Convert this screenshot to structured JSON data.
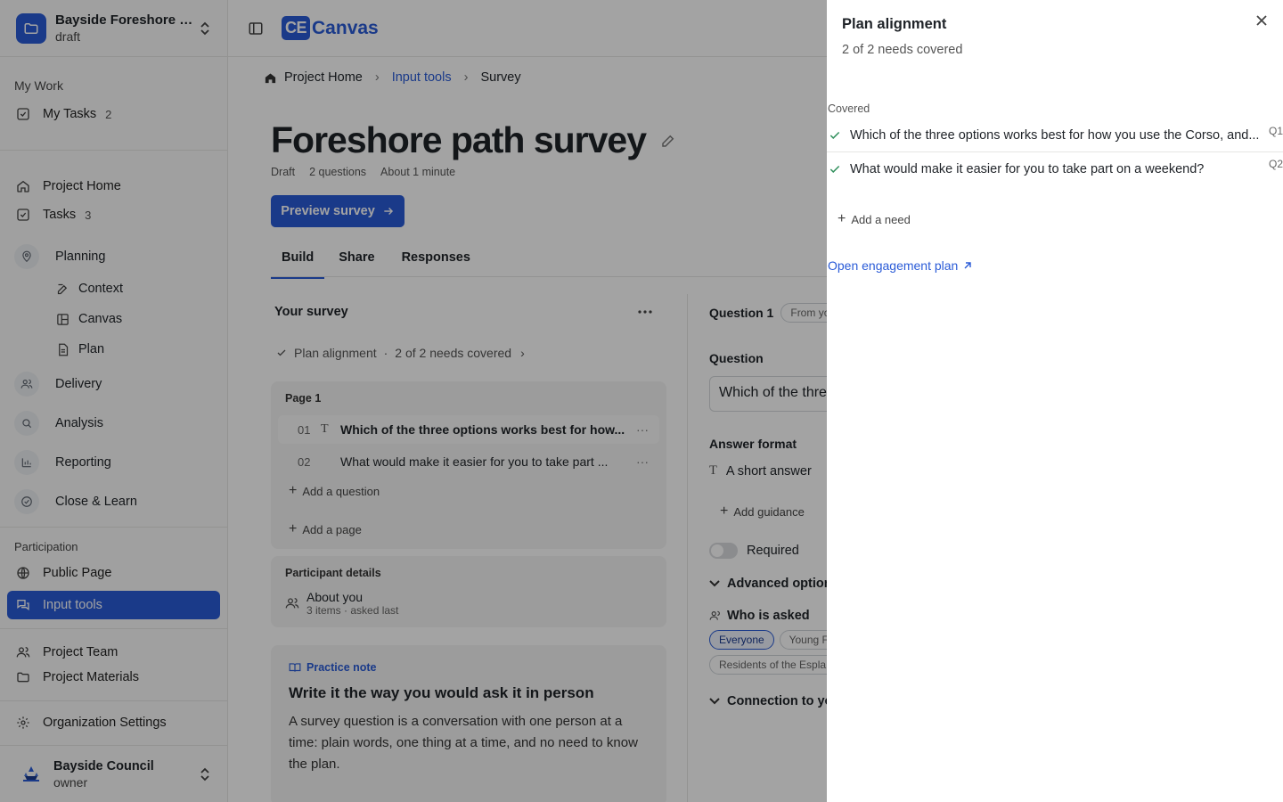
{
  "sidebar": {
    "project": {
      "title": "Bayside Foreshore R...",
      "status": "draft"
    },
    "my_work_label": "My Work",
    "my_tasks": {
      "label": "My Tasks",
      "count": "2"
    },
    "project_home": "Project Home",
    "tasks": {
      "label": "Tasks",
      "count": "3"
    },
    "planning": "Planning",
    "planning_items": [
      "Context",
      "Canvas",
      "Plan"
    ],
    "delivery": "Delivery",
    "analysis": "Analysis",
    "reporting": "Reporting",
    "close_learn": "Close & Learn",
    "participation_label": "Participation",
    "public_page": "Public Page",
    "input_tools": "Input tools",
    "project_team": "Project Team",
    "project_materials": "Project Materials",
    "org_settings": "Organization Settings",
    "org": {
      "name": "Bayside Council",
      "role": "owner"
    }
  },
  "topbar": {
    "logo_mark": "CE",
    "logo_text": "Canvas"
  },
  "breadcrumb": [
    "Project Home",
    "Input tools",
    "Survey"
  ],
  "survey": {
    "title": "Foreshore path survey",
    "meta": [
      "Draft",
      "2 questions",
      "About 1 minute"
    ],
    "preview_label": "Preview survey",
    "tabs": [
      "Build",
      "Share",
      "Responses"
    ],
    "your_survey": "Your survey",
    "alignment_summary": "Plan alignment",
    "alignment_count": "2 of 2 needs covered",
    "page_label": "Page 1",
    "questions": [
      {
        "num": "01",
        "text": "Which of the three options works best for how..."
      },
      {
        "num": "02",
        "text": "What would make it easier for you to take part ..."
      }
    ],
    "add_question": "Add a question",
    "add_page": "Add a page",
    "participant_details": "Participant details",
    "about_you": "About you",
    "about_you_sub": "3 items · asked last",
    "practice_note_label": "Practice note",
    "practice_note_title": "Write it the way you would ask it in person",
    "practice_note_body": "A survey question is a conversation with one person at a time: plain words, one thing at a time, and no need to know the plan."
  },
  "editor": {
    "question_label": "Question 1",
    "from_chip": "From yo",
    "question_heading": "Question",
    "question_value": "Which of the thre",
    "answer_format_heading": "Answer format",
    "answer_format_value": "A short answer",
    "add_guidance": "Add guidance",
    "required_label": "Required",
    "advanced_options": "Advanced option",
    "who_is_asked": "Who is asked",
    "audience_chips": [
      "Everyone",
      "Young F",
      "Residents of the Espla"
    ],
    "connection": "Connection to yo"
  },
  "drawer": {
    "title": "Plan alignment",
    "subtitle": "2 of 2 needs covered",
    "section_label": "Covered",
    "needs": [
      {
        "text": "Which of the three options works best for how you use the Corso, and...",
        "ref": "Q1"
      },
      {
        "text": "What would make it easier for you to take part on a weekend?",
        "ref": "Q2"
      }
    ],
    "add_need": "Add a need",
    "open_plan": "Open engagement plan"
  },
  "colors": {
    "accent": "#2a5bd7",
    "check": "#2f8f5b",
    "overlay": "rgba(0,0,0,0.36)"
  }
}
